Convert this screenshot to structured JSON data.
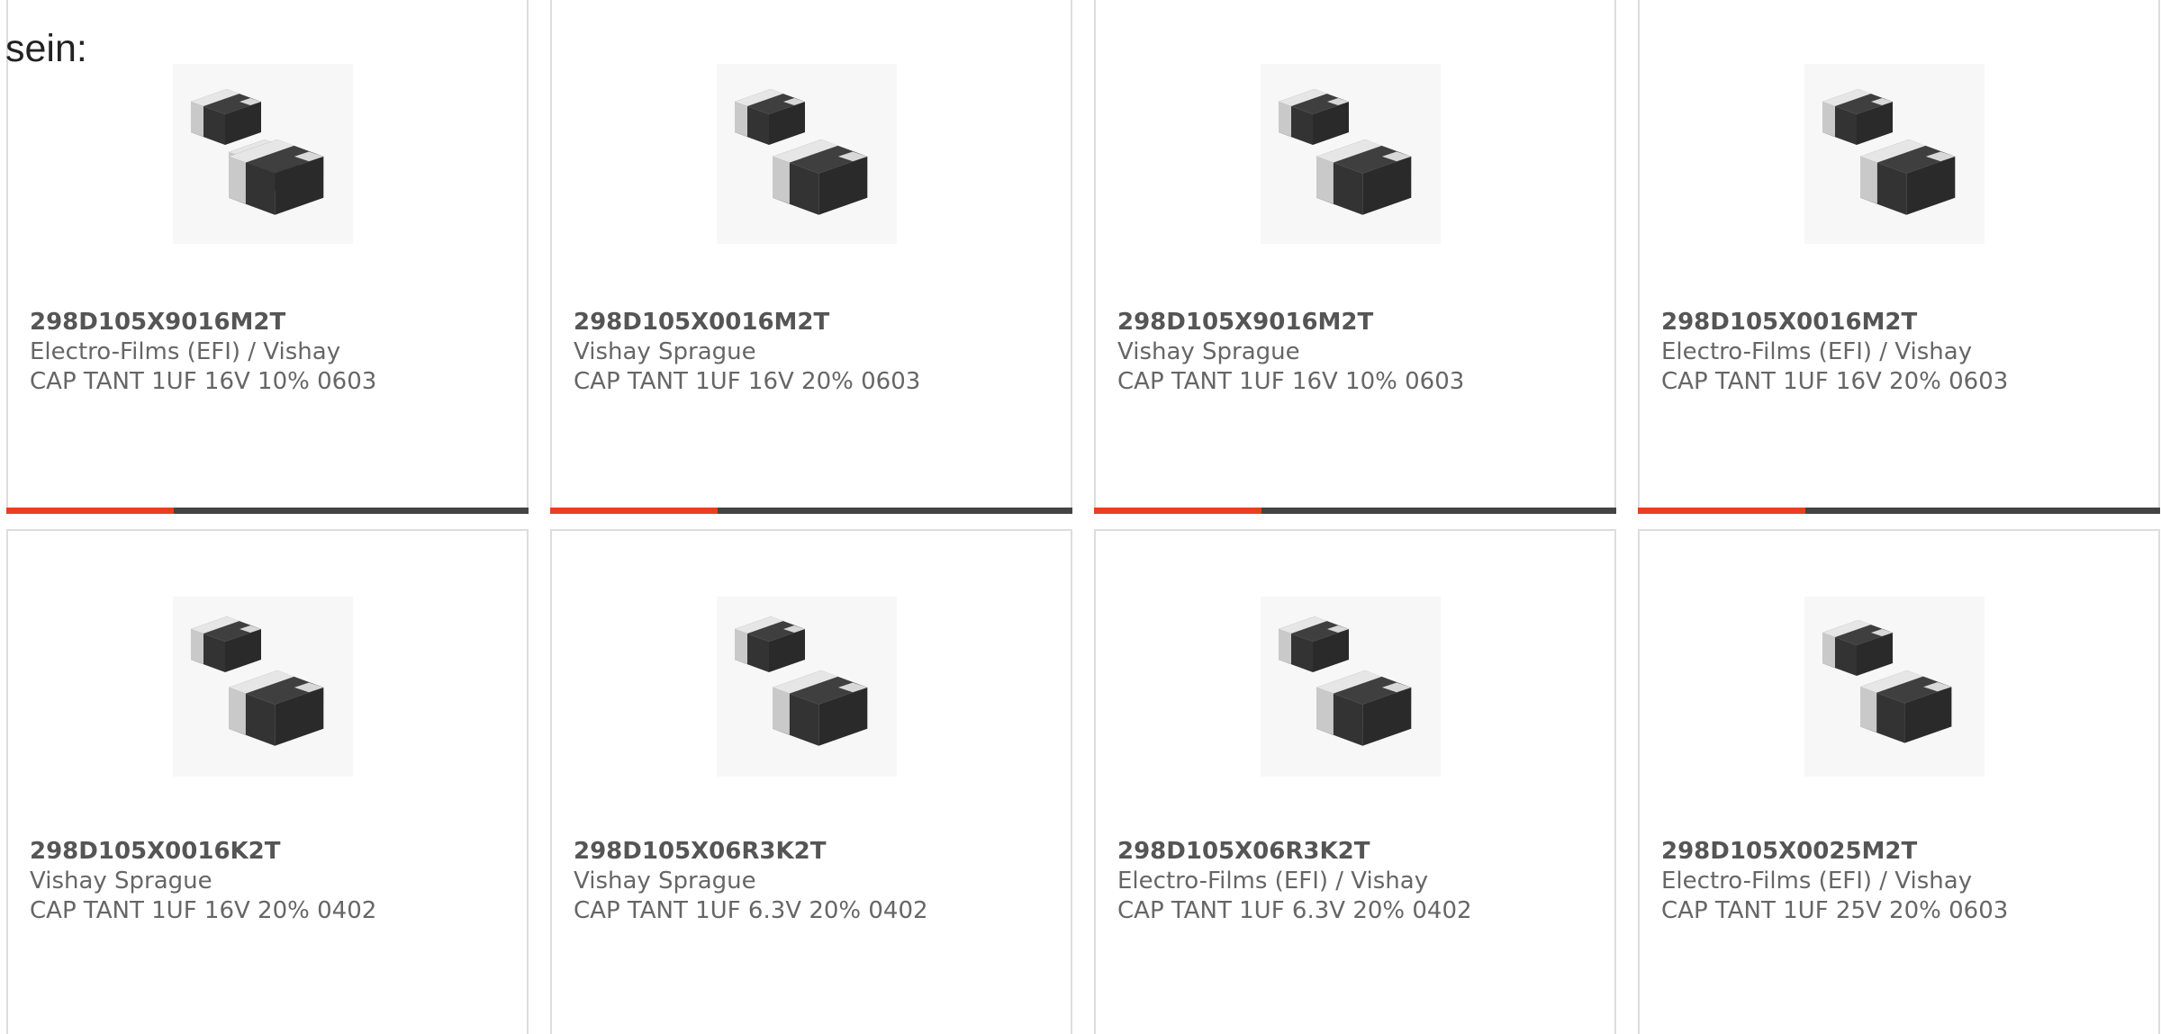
{
  "intro_text": "sein:",
  "colors": {
    "accent": "#e8401c",
    "bar_track": "#444444",
    "card_border": "#dddddd",
    "text": "#666666"
  },
  "cards": [
    {
      "part_number": "298D105X9016M2T",
      "manufacturer": "Electro-Films (EFI) / Vishay",
      "description": "CAP TANT 1UF 16V 10% 0603",
      "image_icon": "smd-capacitor-icon",
      "progress": 0.32
    },
    {
      "part_number": "298D105X0016M2T",
      "manufacturer": "Vishay Sprague",
      "description": "CAP TANT 1UF 16V 20% 0603",
      "image_icon": "smd-capacitor-icon",
      "progress": 0.32
    },
    {
      "part_number": "298D105X9016M2T",
      "manufacturer": "Vishay Sprague",
      "description": "CAP TANT 1UF 16V 10% 0603",
      "image_icon": "smd-capacitor-icon",
      "progress": 0.32
    },
    {
      "part_number": "298D105X0016M2T",
      "manufacturer": "Electro-Films (EFI) / Vishay",
      "description": "CAP TANT 1UF 16V 20% 0603",
      "image_icon": "smd-capacitor-icon",
      "progress": 0.32
    },
    {
      "part_number": "298D105X0016K2T",
      "manufacturer": "Vishay Sprague",
      "description": "CAP TANT 1UF 16V 20% 0402",
      "image_icon": "smd-capacitor-icon"
    },
    {
      "part_number": "298D105X06R3K2T",
      "manufacturer": "Vishay Sprague",
      "description": "CAP TANT 1UF 6.3V 20% 0402",
      "image_icon": "smd-capacitor-icon"
    },
    {
      "part_number": "298D105X06R3K2T",
      "manufacturer": "Electro-Films (EFI) / Vishay",
      "description": "CAP TANT 1UF 6.3V 20% 0402",
      "image_icon": "smd-capacitor-icon"
    },
    {
      "part_number": "298D105X0025M2T",
      "manufacturer": "Electro-Films (EFI) / Vishay",
      "description": "CAP TANT 1UF 25V 20% 0603",
      "image_icon": "smd-capacitor-icon"
    }
  ]
}
